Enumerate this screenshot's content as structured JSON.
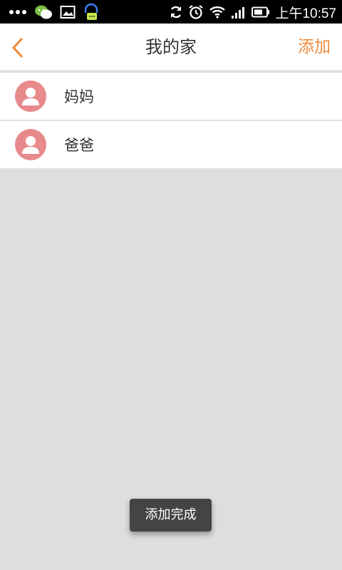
{
  "status_bar": {
    "time": "上午10:57",
    "icons": [
      "more-dots-icon",
      "wechat-icon",
      "image-icon",
      "headset-chat-icon",
      "sync-icon",
      "alarm-icon",
      "wifi-icon",
      "signal-icon",
      "battery-icon"
    ]
  },
  "nav": {
    "title": "我的家",
    "add_label": "添加",
    "back_icon": "chevron-left-icon"
  },
  "members": [
    {
      "name": "妈妈",
      "avatar_icon": "person-avatar-icon"
    },
    {
      "name": "爸爸",
      "avatar_icon": "person-avatar-icon"
    }
  ],
  "toast": {
    "text": "添加完成"
  },
  "colors": {
    "accent": "#f08a3a",
    "avatar_bg": "#e8898c",
    "background": "#dedede"
  }
}
